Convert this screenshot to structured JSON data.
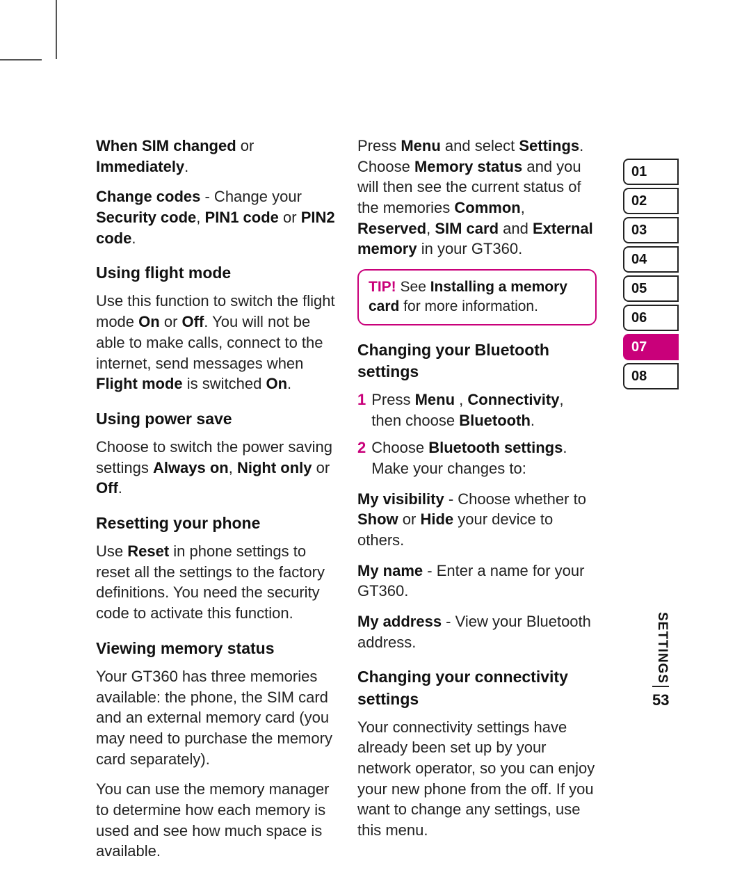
{
  "left_column": {
    "para1": {
      "segments": [
        {
          "text": "When SIM changed",
          "bold": true
        },
        {
          "text": " or ",
          "bold": false
        },
        {
          "text": "Immediately",
          "bold": true
        },
        {
          "text": ".",
          "bold": false
        }
      ]
    },
    "para2": {
      "segments": [
        {
          "text": "Change codes",
          "bold": true
        },
        {
          "text": " - Change your ",
          "bold": false
        },
        {
          "text": "Security code",
          "bold": true
        },
        {
          "text": ", ",
          "bold": false
        },
        {
          "text": "PIN1 code",
          "bold": true
        },
        {
          "text": " or ",
          "bold": false
        },
        {
          "text": "PIN2 code",
          "bold": true
        },
        {
          "text": ".",
          "bold": false
        }
      ]
    },
    "h_flight": "Using flight mode",
    "para_flight": {
      "segments": [
        {
          "text": "Use this function to switch the flight mode ",
          "bold": false
        },
        {
          "text": "On",
          "bold": true
        },
        {
          "text": " or ",
          "bold": false
        },
        {
          "text": "Off",
          "bold": true
        },
        {
          "text": ". You will not be able to make calls, connect to the internet, send messages  when ",
          "bold": false
        },
        {
          "text": "Flight mode",
          "bold": true
        },
        {
          "text": " is switched ",
          "bold": false
        },
        {
          "text": "On",
          "bold": true
        },
        {
          "text": ".",
          "bold": false
        }
      ]
    },
    "h_power": "Using power save",
    "para_power": {
      "segments": [
        {
          "text": "Choose to switch the power saving settings ",
          "bold": false
        },
        {
          "text": "Always on",
          "bold": true
        },
        {
          "text": ", ",
          "bold": false
        },
        {
          "text": "Night only",
          "bold": true
        },
        {
          "text": " or ",
          "bold": false
        },
        {
          "text": "Off",
          "bold": true
        },
        {
          "text": ".",
          "bold": false
        }
      ]
    },
    "h_reset": "Resetting your phone",
    "para_reset": {
      "segments": [
        {
          "text": "Use ",
          "bold": false
        },
        {
          "text": "Reset",
          "bold": true
        },
        {
          "text": " in phone settings to reset all the settings to the factory definitions. You need the security code to activate this function.",
          "bold": false
        }
      ]
    },
    "h_memory": "Viewing memory status",
    "para_memory1": {
      "segments": [
        {
          "text": "Your GT360 has three memories available: the phone, the SIM card and an external memory card (you may need to purchase the memory card separately).",
          "bold": false
        }
      ]
    },
    "para_memory2": {
      "segments": [
        {
          "text": "You can use the memory manager to determine how each memory is used and see how much space is available.",
          "bold": false
        }
      ]
    }
  },
  "right_column": {
    "para_memstatus": {
      "segments": [
        {
          "text": "Press ",
          "bold": false
        },
        {
          "text": "Menu",
          "bold": true
        },
        {
          "text": " and select ",
          "bold": false
        },
        {
          "text": "Settings",
          "bold": true
        },
        {
          "text": ". Choose ",
          "bold": false
        },
        {
          "text": "Memory status",
          "bold": true
        },
        {
          "text": " and you will then see the current status of the memories ",
          "bold": false
        },
        {
          "text": "Common",
          "bold": true
        },
        {
          "text": ", ",
          "bold": false
        },
        {
          "text": "Reserved",
          "bold": true
        },
        {
          "text": ", ",
          "bold": false
        },
        {
          "text": "SIM card",
          "bold": true
        },
        {
          "text": " and ",
          "bold": false
        },
        {
          "text": "External memory",
          "bold": true
        },
        {
          "text": " in your GT360.",
          "bold": false
        }
      ]
    },
    "tip_label": "TIP!",
    "tip_body": {
      "segments": [
        {
          "text": " See ",
          "bold": false
        },
        {
          "text": "Installing a memory card",
          "bold": true
        },
        {
          "text": "  for more information.",
          "bold": false
        }
      ]
    },
    "h_bt": "Changing your Bluetooth settings",
    "bt_steps": [
      {
        "num": "1",
        "segments": [
          {
            "text": "Press ",
            "bold": false
          },
          {
            "text": "Menu",
            "bold": true
          },
          {
            "text": " , ",
            "bold": false
          },
          {
            "text": "Connectivity",
            "bold": true
          },
          {
            "text": ", then choose ",
            "bold": false
          },
          {
            "text": "Bluetooth",
            "bold": true
          },
          {
            "text": ".",
            "bold": false
          }
        ]
      },
      {
        "num": "2",
        "segments": [
          {
            "text": "Choose ",
            "bold": false
          },
          {
            "text": "Bluetooth settings",
            "bold": true
          },
          {
            "text": ". Make your changes to:",
            "bold": false
          }
        ]
      }
    ],
    "para_vis": {
      "segments": [
        {
          "text": "My visibility",
          "bold": true
        },
        {
          "text": " - Choose whether to ",
          "bold": false
        },
        {
          "text": "Show",
          "bold": true
        },
        {
          "text": " or ",
          "bold": false
        },
        {
          "text": "Hide",
          "bold": true
        },
        {
          "text": " your device to others.",
          "bold": false
        }
      ]
    },
    "para_name": {
      "segments": [
        {
          "text": "My name",
          "bold": true
        },
        {
          "text": " - Enter a name for your GT360.",
          "bold": false
        }
      ]
    },
    "para_addr": {
      "segments": [
        {
          "text": "My address",
          "bold": true
        },
        {
          "text": " - View your Bluetooth address.",
          "bold": false
        }
      ]
    },
    "h_conn": "Changing your connectivity settings",
    "para_conn": {
      "segments": [
        {
          "text": "Your connectivity settings have already been set up by your network operator, so you can enjoy your new phone from the off. If you want to change any settings, use this menu.",
          "bold": false
        }
      ]
    }
  },
  "tabs": [
    {
      "label": "01",
      "active": false
    },
    {
      "label": "02",
      "active": false
    },
    {
      "label": "03",
      "active": false
    },
    {
      "label": "04",
      "active": false
    },
    {
      "label": "05",
      "active": false
    },
    {
      "label": "06",
      "active": false
    },
    {
      "label": "07",
      "active": true
    },
    {
      "label": "08",
      "active": false
    }
  ],
  "section_label": "SETTINGS",
  "page_number": "53"
}
